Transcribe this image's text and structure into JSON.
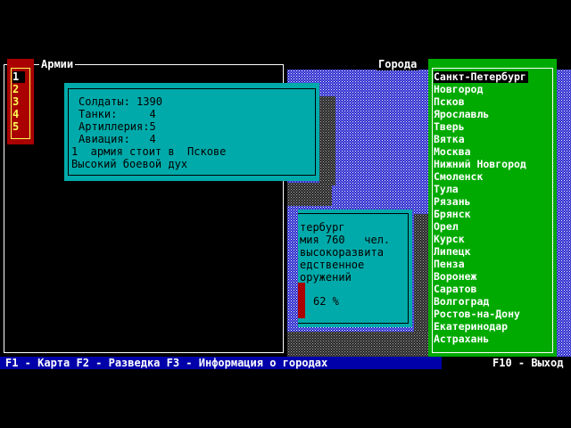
{
  "armies": {
    "title": "Армии",
    "items": [
      "1",
      "2",
      "3",
      "4",
      "5"
    ],
    "selected_index": 0
  },
  "army_info": {
    "soldiers": "Солдаты: 1390",
    "tanks": "Танки:     4",
    "artillery": "Артиллерия:5",
    "aviation": "Авиация:   4",
    "location": "1  армия стоит в  Пскове",
    "morale": "Высокий боевой дух"
  },
  "city_info": {
    "line1": "тербург",
    "line2": "мия 760   чел.",
    "line3": "высокоразвита",
    "line4": "едственное",
    "line5": "оружений",
    "percent": "62 %"
  },
  "cities": {
    "title": "Города",
    "items": [
      "Санкт-Петербург",
      "Новгород",
      "Псков",
      "Ярославль",
      "Тверь",
      "Вятка",
      "Москва",
      "Нижний Новгород",
      "Смоленск",
      "Тула",
      "Рязань",
      "Брянск",
      "Орел",
      "Курск",
      "Липецк",
      "Пенза",
      "Воронеж",
      "Саратов",
      "Волгоград",
      "Ростов-на-Дону",
      "Екатеринодар",
      "Астрахань"
    ],
    "selected_index": 0
  },
  "status_bar": {
    "text": "F1 - Карта F2 - Разведка F3 - Информация о городах",
    "f10": "F10 - Выход"
  },
  "colors": {
    "background": "#000000",
    "map_blue": "#2222cc",
    "popup_cyan": "#00aaaa",
    "cities_green": "#00aa00",
    "armies_red": "#aa0000",
    "status_blue": "#0000aa"
  }
}
